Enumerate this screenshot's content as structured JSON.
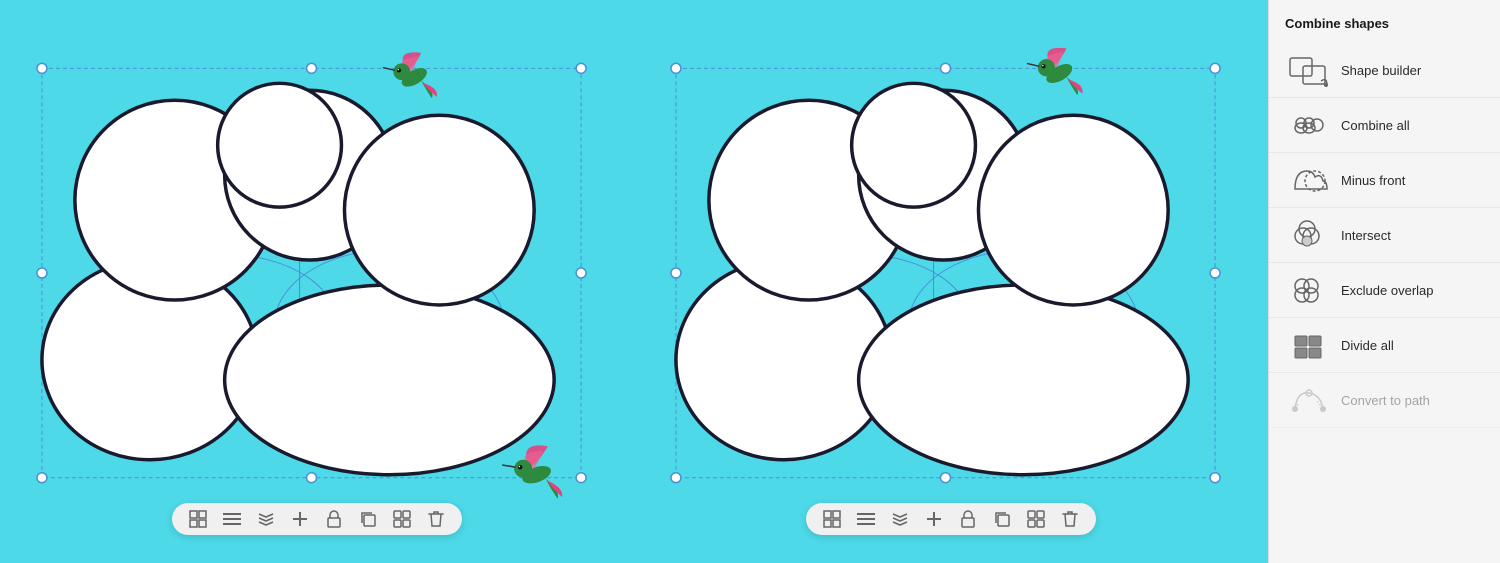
{
  "sidebar": {
    "title": "Combine shapes",
    "items": [
      {
        "id": "shape-builder",
        "label": "Shape builder",
        "icon": "shape-builder-icon",
        "disabled": false
      },
      {
        "id": "combine-all",
        "label": "Combine all",
        "icon": "combine-all-icon",
        "disabled": false
      },
      {
        "id": "minus-front",
        "label": "Minus front",
        "icon": "minus-front-icon",
        "disabled": false
      },
      {
        "id": "intersect",
        "label": "Intersect",
        "icon": "intersect-icon",
        "disabled": false
      },
      {
        "id": "exclude-overlap",
        "label": "Exclude overlap",
        "icon": "exclude-overlap-icon",
        "disabled": false
      },
      {
        "id": "divide-all",
        "label": "Divide all",
        "icon": "divide-all-icon",
        "disabled": false
      },
      {
        "id": "convert-to-path",
        "label": "Convert to path",
        "icon": "convert-to-path-icon",
        "disabled": true
      }
    ]
  },
  "toolbar": {
    "icons": [
      "grid",
      "menu",
      "layers",
      "add",
      "lock",
      "duplicate",
      "group",
      "delete"
    ]
  },
  "colors": {
    "background": "#4dd9e8",
    "white": "#ffffff",
    "dark": "#1a1a2e",
    "blue_outline": "#5b9bd5",
    "sidebar_bg": "#f5f5f5"
  }
}
